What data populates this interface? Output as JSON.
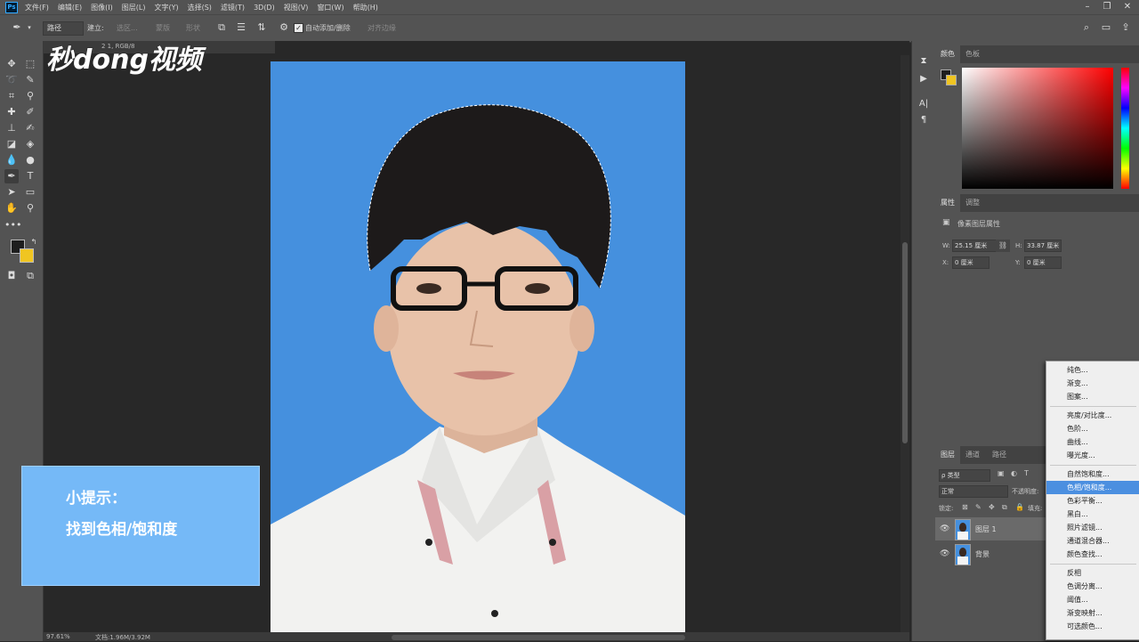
{
  "app": {
    "logo": "Ps",
    "menu": [
      "文件(F)",
      "编辑(E)",
      "图像(I)",
      "图层(L)",
      "文字(Y)",
      "选择(S)",
      "滤镜(T)",
      "3D(D)",
      "视图(V)",
      "窗口(W)",
      "帮助(H)"
    ]
  },
  "options_bar": {
    "mode": "路径",
    "make_label": "建立:",
    "selection_btn": "选区...",
    "mask_btn": "蒙版",
    "shape_btn": "形状",
    "auto_add_delete": "自动添加/删除",
    "align_edges": "对齐边缘"
  },
  "document": {
    "tab_title": "2 1, RGB/8",
    "zoom": "97.61%",
    "doc_size": "文档:1.96M/3.92M"
  },
  "watermark": {
    "text": "秒dong视频"
  },
  "tip": {
    "line1": "小提示：",
    "line2": "找到色相/饱和度"
  },
  "color_panel": {
    "tabs": [
      "颜色",
      "色板"
    ],
    "foreground": "#1e1e1e",
    "background": "#f0c521"
  },
  "properties_panel": {
    "tabs": [
      "属性",
      "调整"
    ],
    "title": "像素图层属性",
    "w_label": "W:",
    "w_value": "25.15 厘米",
    "h_label": "H:",
    "h_value": "33.87 厘米",
    "x_label": "X:",
    "x_value": "0 厘米",
    "y_label": "Y:",
    "y_value": "0 厘米"
  },
  "layers_panel": {
    "tabs": [
      "图层",
      "通道",
      "路径"
    ],
    "filter_kind": "ρ 类型",
    "blend_mode": "正常",
    "opacity_label": "不透明度:",
    "lock_label": "锁定:",
    "fill_label": "填充:",
    "layers": [
      {
        "name": "图层 1",
        "visible": true,
        "selected": true
      },
      {
        "name": "背景",
        "visible": true,
        "selected": false
      }
    ]
  },
  "adjustment_menu": {
    "items": [
      {
        "label": "纯色..."
      },
      {
        "label": "渐变..."
      },
      {
        "label": "图案..."
      },
      {
        "label": "亮度/对比度..."
      },
      {
        "label": "色阶..."
      },
      {
        "label": "曲线..."
      },
      {
        "label": "曝光度..."
      },
      {
        "label": "自然饱和度..."
      },
      {
        "label": "色相/饱和度...",
        "highlighted": true
      },
      {
        "label": "色彩平衡..."
      },
      {
        "label": "黑白..."
      },
      {
        "label": "照片滤镜..."
      },
      {
        "label": "通道混合器..."
      },
      {
        "label": "颜色查找..."
      },
      {
        "label": "反相"
      },
      {
        "label": "色调分离..."
      },
      {
        "label": "阈值..."
      },
      {
        "label": "渐变映射..."
      },
      {
        "label": "可选颜色..."
      }
    ]
  },
  "colors": {
    "canvas_blue": "#4590de",
    "highlight": "#4b8fe0"
  }
}
